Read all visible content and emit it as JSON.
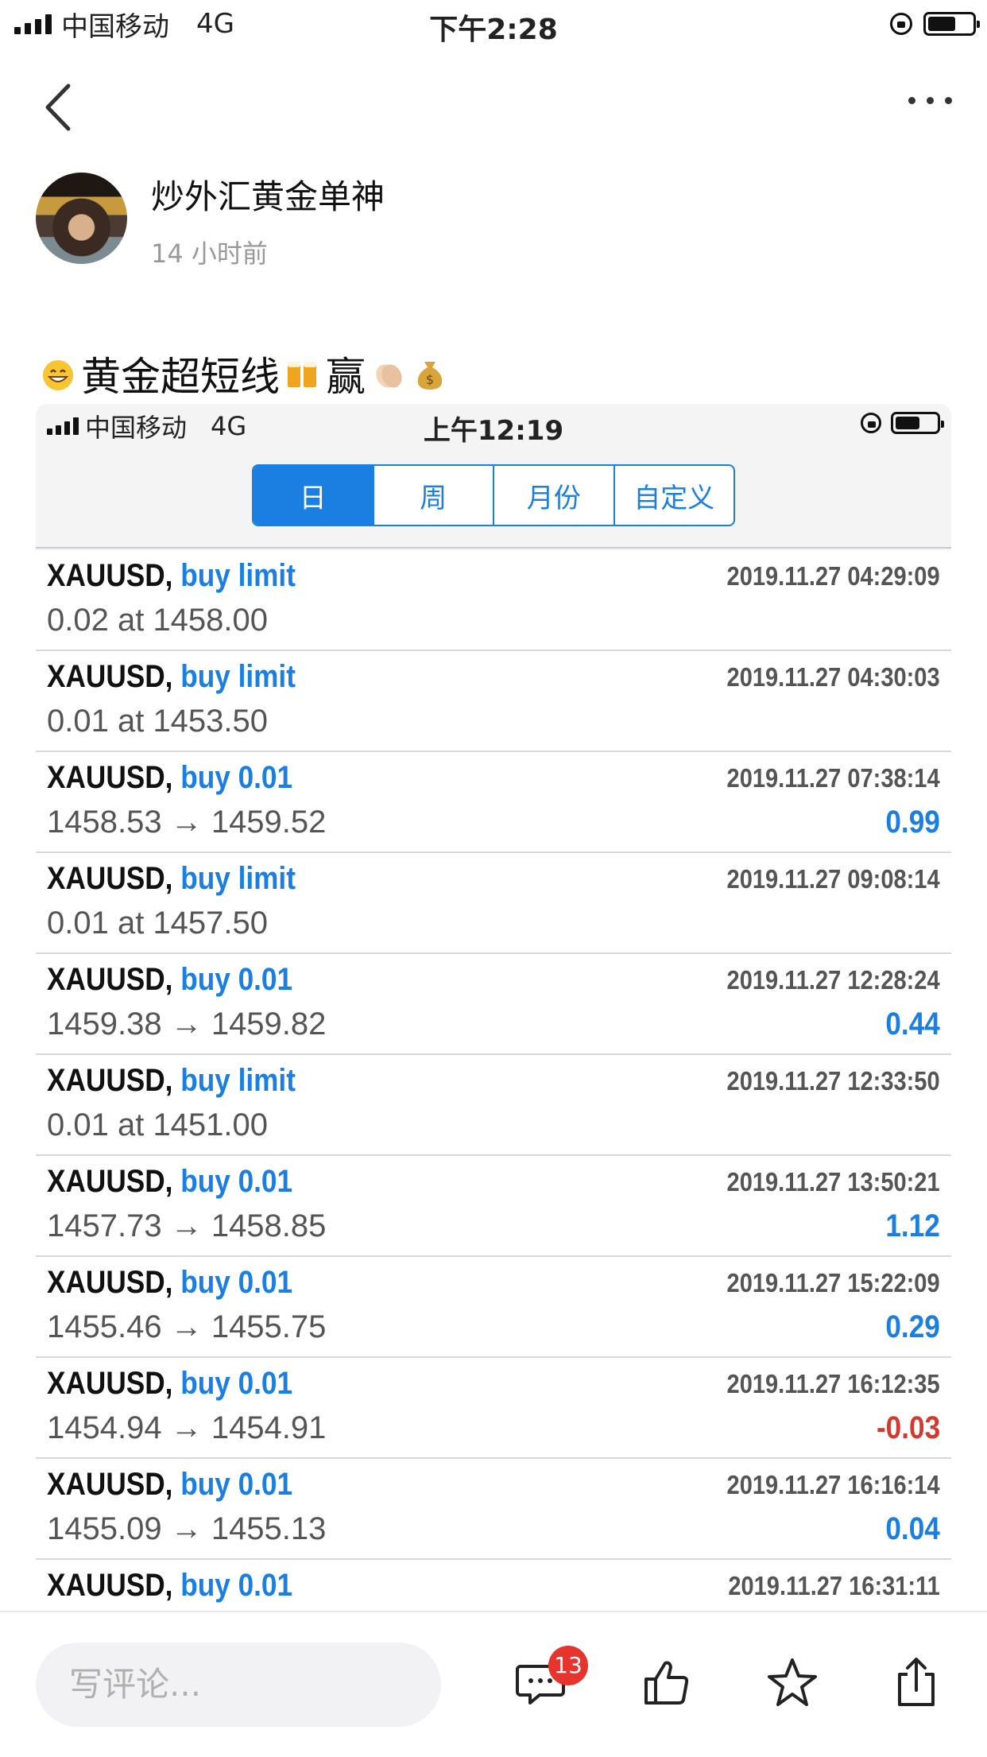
{
  "status_bar": {
    "carrier": "中国移动",
    "network": "4G",
    "time": "下午2:28"
  },
  "post": {
    "author": "炒外汇黄金单神",
    "time_ago": "14 小时前",
    "title_left": "黄金超短线",
    "title_mid": "赢",
    "emojis": [
      "grinning-face-emoji",
      "clinking-beer-emoji",
      "clapping-hands-emoji",
      "money-bag-emoji"
    ]
  },
  "inner_status_bar": {
    "carrier": "中国移动",
    "network": "4G",
    "time": "上午12:19"
  },
  "tabs": [
    {
      "label": "日",
      "active": true
    },
    {
      "label": "周",
      "active": false
    },
    {
      "label": "月份",
      "active": false
    },
    {
      "label": "自定义",
      "active": false
    }
  ],
  "orders": [
    {
      "symbol": "XAUUSD,",
      "action": "buy limit",
      "time": "2019.11.27 04:29:09",
      "detail": "0.02 at 1458.00",
      "profit": "",
      "profit_type": ""
    },
    {
      "symbol": "XAUUSD,",
      "action": "buy limit",
      "time": "2019.11.27 04:30:03",
      "detail": "0.01 at 1453.50",
      "profit": "",
      "profit_type": ""
    },
    {
      "symbol": "XAUUSD,",
      "action": "buy 0.01",
      "time": "2019.11.27 07:38:14",
      "detail": "1458.53 → 1459.52",
      "profit": "0.99",
      "profit_type": "pos"
    },
    {
      "symbol": "XAUUSD,",
      "action": "buy limit",
      "time": "2019.11.27 09:08:14",
      "detail": "0.01 at 1457.50",
      "profit": "",
      "profit_type": ""
    },
    {
      "symbol": "XAUUSD,",
      "action": "buy 0.01",
      "time": "2019.11.27 12:28:24",
      "detail": "1459.38 → 1459.82",
      "profit": "0.44",
      "profit_type": "pos"
    },
    {
      "symbol": "XAUUSD,",
      "action": "buy limit",
      "time": "2019.11.27 12:33:50",
      "detail": "0.01 at 1451.00",
      "profit": "",
      "profit_type": ""
    },
    {
      "symbol": "XAUUSD,",
      "action": "buy 0.01",
      "time": "2019.11.27 13:50:21",
      "detail": "1457.73 → 1458.85",
      "profit": "1.12",
      "profit_type": "pos"
    },
    {
      "symbol": "XAUUSD,",
      "action": "buy 0.01",
      "time": "2019.11.27 15:22:09",
      "detail": "1455.46 → 1455.75",
      "profit": "0.29",
      "profit_type": "pos"
    },
    {
      "symbol": "XAUUSD,",
      "action": "buy 0.01",
      "time": "2019.11.27 16:12:35",
      "detail": "1454.94 → 1454.91",
      "profit": "-0.03",
      "profit_type": "neg"
    },
    {
      "symbol": "XAUUSD,",
      "action": "buy 0.01",
      "time": "2019.11.27 16:16:14",
      "detail": "1455.09 → 1455.13",
      "profit": "0.04",
      "profit_type": "pos"
    },
    {
      "symbol": "XAUUSD,",
      "action": "buy 0.01",
      "time": "2019.11.27 16:31:11",
      "detail": "",
      "profit": "",
      "profit_type": ""
    }
  ],
  "bottom_bar": {
    "comment_placeholder": "写评论...",
    "comment_count": "13"
  },
  "colors": {
    "accent": "#1a7fe0",
    "negative": "#d23a2f",
    "badge": "#e8342e"
  }
}
